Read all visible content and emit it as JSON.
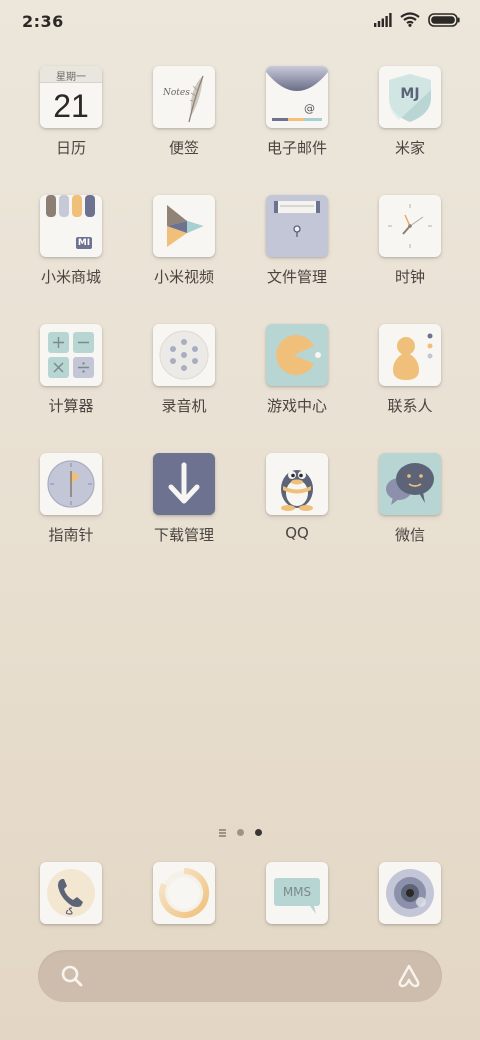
{
  "status": {
    "time": "2:36"
  },
  "calendar": {
    "weekday": "星期一",
    "day": "21"
  },
  "notes_icon_text": "Notes",
  "mijia_icon_text": "MJ",
  "mall_icon_text": "MI",
  "mms_icon_text": "MMS",
  "apps": [
    {
      "label": "日历"
    },
    {
      "label": "便签"
    },
    {
      "label": "电子邮件"
    },
    {
      "label": "米家"
    },
    {
      "label": "小米商城"
    },
    {
      "label": "小米视频"
    },
    {
      "label": "文件管理"
    },
    {
      "label": "时钟"
    },
    {
      "label": "计算器"
    },
    {
      "label": "录音机"
    },
    {
      "label": "游戏中心"
    },
    {
      "label": "联系人"
    },
    {
      "label": "指南针"
    },
    {
      "label": "下载管理"
    },
    {
      "label": "QQ"
    },
    {
      "label": "微信"
    }
  ],
  "pager": {
    "pages": 2,
    "current_page": 2
  },
  "dock": [
    {
      "icon": "phone-icon"
    },
    {
      "icon": "browser-icon"
    },
    {
      "icon": "messages-icon"
    },
    {
      "icon": "camera-icon"
    }
  ],
  "search": {
    "left_icon": "search-icon",
    "right_icon": "assistant-icon"
  }
}
